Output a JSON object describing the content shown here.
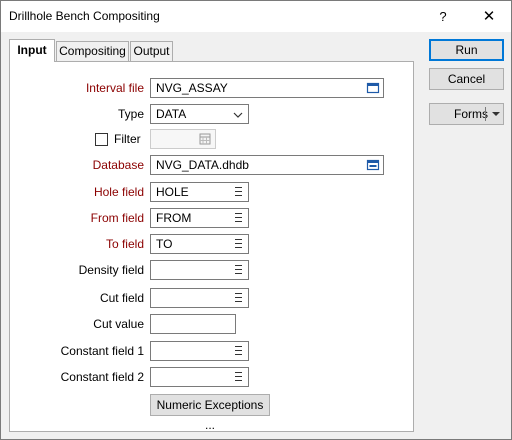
{
  "window": {
    "title": "Drillhole Bench Compositing",
    "help": "?",
    "close": "✕"
  },
  "tabs": [
    {
      "label": "Input",
      "active": true
    },
    {
      "label": "Compositing",
      "active": false
    },
    {
      "label": "Output",
      "active": false
    }
  ],
  "buttons": {
    "run": "Run",
    "cancel": "Cancel",
    "forms": "Forms"
  },
  "form": {
    "interval_file": {
      "label": "Interval file",
      "value": "NVG_ASSAY"
    },
    "type": {
      "label": "Type",
      "value": "DATA"
    },
    "filter": {
      "label": "Filter",
      "checked": false,
      "value": ""
    },
    "database": {
      "label": "Database",
      "value": "NVG_DATA.dhdb"
    },
    "hole_field": {
      "label": "Hole field",
      "value": "HOLE"
    },
    "from_field": {
      "label": "From field",
      "value": "FROM"
    },
    "to_field": {
      "label": "To field",
      "value": "TO"
    },
    "density_field": {
      "label": "Density field",
      "value": ""
    },
    "cut_field": {
      "label": "Cut field",
      "value": ""
    },
    "cut_value": {
      "label": "Cut value",
      "value": ""
    },
    "constant_field_1": {
      "label": "Constant field 1",
      "value": ""
    },
    "constant_field_2": {
      "label": "Constant field 2",
      "value": ""
    },
    "numeric_exceptions": "Numeric Exceptions ..."
  },
  "colors": {
    "required_label": "#8b0000",
    "default_button_border": "#0078d7"
  },
  "icons": {
    "file_browse": "folder-browse-icon",
    "list": "list-icon",
    "calendar": "calendar-icon",
    "dropdown": "chevron-down-icon"
  }
}
